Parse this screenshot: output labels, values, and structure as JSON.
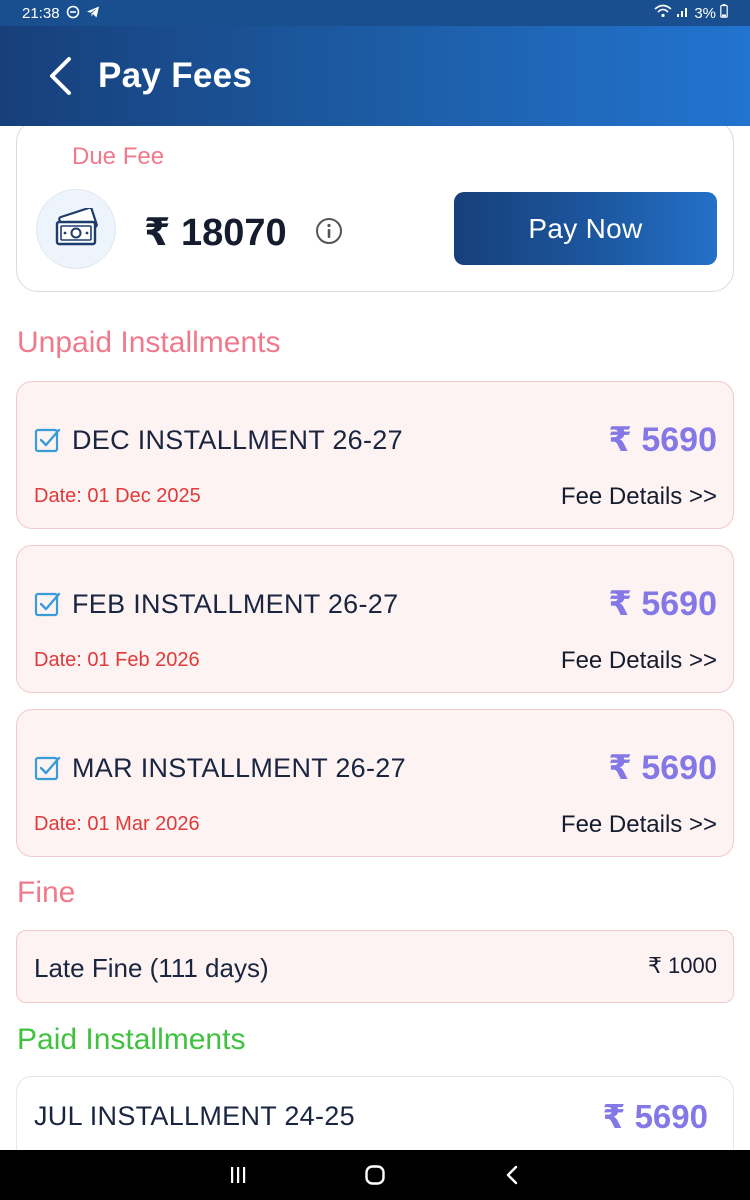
{
  "status_bar": {
    "time": "21:38",
    "battery": "3%"
  },
  "app_bar": {
    "title": "Pay Fees"
  },
  "due_fee": {
    "label": "Due Fee",
    "amount": "₹ 18070",
    "pay_button": "Pay Now"
  },
  "unpaid": {
    "title": "Unpaid Installments",
    "items": [
      {
        "name": "DEC INSTALLMENT 26-27",
        "amount": "₹ 5690",
        "date": "Date: 01 Dec 2025",
        "details": "Fee Details >>"
      },
      {
        "name": "FEB INSTALLMENT 26-27",
        "amount": "₹ 5690",
        "date": "Date: 01 Feb 2026",
        "details": "Fee Details >>"
      },
      {
        "name": "MAR INSTALLMENT 26-27",
        "amount": "₹ 5690",
        "date": "Date: 01 Mar 2026",
        "details": "Fee Details >>"
      }
    ]
  },
  "fine": {
    "title": "Fine",
    "label": "Late Fine (111 days)",
    "amount": "₹ 1000"
  },
  "paid": {
    "title": "Paid Installments",
    "items": [
      {
        "name": "JUL INSTALLMENT 24-25",
        "amount": "₹  5690"
      }
    ]
  },
  "colors": {
    "primary": "#1d5aa3",
    "accent_pink": "#f07a8c",
    "accent_green": "#3fc23f",
    "amount_purple": "#8478e6",
    "date_red": "#e03a3a"
  },
  "icons": [
    "back-arrow-icon",
    "money-icon",
    "info-icon",
    "checkbox-checked-icon",
    "recents-icon",
    "home-icon",
    "nav-back-icon"
  ]
}
